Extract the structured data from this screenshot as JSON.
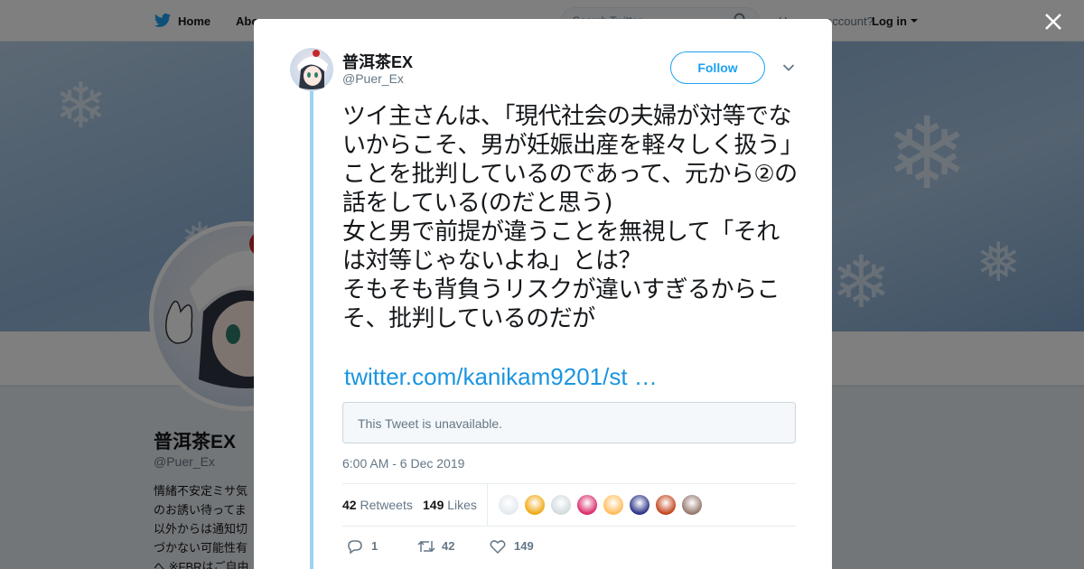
{
  "background_page": {
    "nav": {
      "home_label": "Home",
      "about_label": "Abo",
      "search_placeholder": "Search Twitter",
      "have_account_text": "Have an account?",
      "login_label": "Log in"
    },
    "profile": {
      "name": "普洱茶EX",
      "handle": "@Puer_Ex",
      "bio": "情緒不安定ミサ気\nのお誘い待ってま\n以外からは通知切\nづかない可能性有\nへ ※FBRはご自由"
    }
  },
  "modal": {
    "author": {
      "name": "普洱茶EX",
      "handle": "@Puer_Ex"
    },
    "follow_label": "Follow",
    "tweet_text": "ツイ主さんは、「現代社会の夫婦が対等でないからこそ、男が妊娠出産を軽々しく扱う」ことを批判しているのであって、元から②の話をしている(のだと思う)\n女と男で前提が違うことを無視して「それは対等じゃないよね」とは？\nそもそも背負うリスクが違いすぎるからこそ、批判しているのだが",
    "tweet_link": "twitter.com/kanikam9201/st …",
    "quote_unavailable": "This Tweet is unavailable.",
    "timestamp": "6:00 AM - 6 Dec 2019",
    "stats": {
      "retweets_count": "42",
      "retweets_label": "Retweets",
      "likes_count": "149",
      "likes_label": "Likes"
    },
    "liker_avatar_colors": [
      "#e1e8ed",
      "#f0a202",
      "#cfd8dc",
      "#d81b60",
      "#ffb74d",
      "#1a237e",
      "#bf360c",
      "#8d6e63"
    ],
    "actions": {
      "reply_count": "1",
      "retweet_count": "42",
      "like_count": "149"
    }
  },
  "colors": {
    "accent": "#1da1f2",
    "link": "#1b95e0",
    "thread_line": "#9ad4f2"
  }
}
